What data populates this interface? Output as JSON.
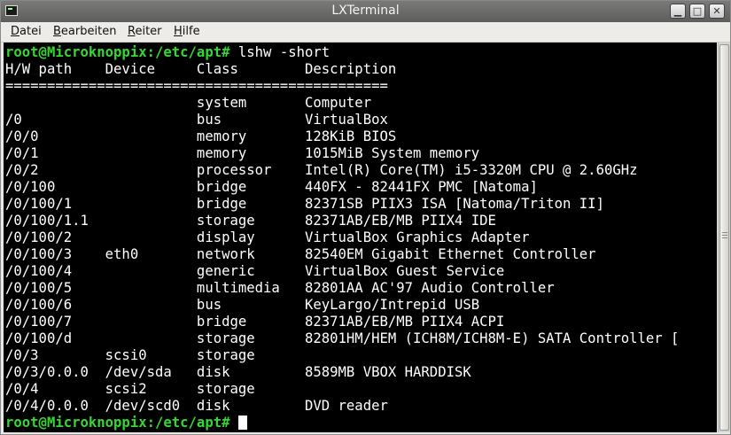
{
  "window": {
    "title": "LXTerminal"
  },
  "menu": [
    {
      "u": "D",
      "rest": "atei"
    },
    {
      "u": "B",
      "rest": "earbeiten"
    },
    {
      "u": "R",
      "rest": "eiter"
    },
    {
      "u": "H",
      "rest": "ilfe"
    }
  ],
  "terminal": {
    "prompt": "root@Microknoppix:/etc/apt#",
    "command": " lshw -short",
    "lines": [
      "H/W path    Device     Class        Description",
      "==============================================",
      "                       system       Computer",
      "/0                     bus          VirtualBox",
      "/0/0                   memory       128KiB BIOS",
      "/0/1                   memory       1015MiB System memory",
      "/0/2                   processor    Intel(R) Core(TM) i5-3320M CPU @ 2.60GHz",
      "/0/100                 bridge       440FX - 82441FX PMC [Natoma]",
      "/0/100/1               bridge       82371SB PIIX3 ISA [Natoma/Triton II]",
      "/0/100/1.1             storage      82371AB/EB/MB PIIX4 IDE",
      "/0/100/2               display      VirtualBox Graphics Adapter",
      "/0/100/3    eth0       network      82540EM Gigabit Ethernet Controller",
      "/0/100/4               generic      VirtualBox Guest Service",
      "/0/100/5               multimedia   82801AA AC'97 Audio Controller",
      "/0/100/6               bus          KeyLargo/Intrepid USB",
      "/0/100/7               bridge       82371AB/EB/MB PIIX4 ACPI",
      "/0/100/d               storage      82801HM/HEM (ICH8M/ICH8M-E) SATA Controller [",
      "/0/3        scsi0      storage",
      "/0/3/0.0.0  /dev/sda   disk         8589MB VBOX HARDDISK",
      "/0/4        scsi2      storage",
      "/0/4/0.0.0  /dev/scd0  disk         DVD reader"
    ]
  }
}
